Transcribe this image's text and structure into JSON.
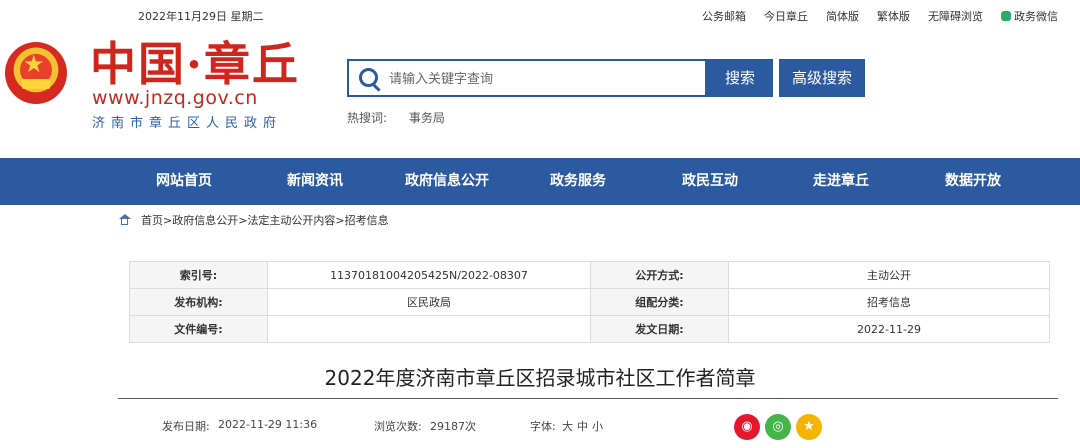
{
  "topbar": {
    "date": "2022年11月29日 星期二",
    "links": [
      "公务邮箱",
      "今日章丘",
      "简体版",
      "繁体版",
      "无障碍浏览"
    ],
    "wechat_label": "政务微信",
    "wechat_color": "#2aae67"
  },
  "logo": {
    "title": "中国·章丘",
    "url": "www.jnzq.gov.cn",
    "subtitle": "济南市章丘区人民政府",
    "emblem_icon": "national-emblem-icon"
  },
  "search": {
    "placeholder": "请输入关键字查询",
    "search_button": "搜索",
    "advanced_button": "高级搜索",
    "hot_label": "热搜词:",
    "hot_keywords": [
      "事务局"
    ]
  },
  "nav": {
    "items": [
      "网站首页",
      "新闻资讯",
      "政府信息公开",
      "政务服务",
      "政民互动",
      "走进章丘",
      "数据开放"
    ],
    "background": "#2c5aa0"
  },
  "breadcrumb": {
    "icon": "home-icon",
    "path": "首页>政府信息公开>法定主动公开内容>招考信息"
  },
  "meta": {
    "rows": [
      {
        "k1": "索引号:",
        "v1": "11370181004205425N/2022-08307",
        "k2": "公开方式:",
        "v2": "主动公开"
      },
      {
        "k1": "发布机构:",
        "v1": "区民政局",
        "k2": "组配分类:",
        "v2": "招考信息"
      },
      {
        "k1": "文件编号:",
        "v1": "",
        "k2": "发文日期:",
        "v2": "2022-11-29"
      }
    ]
  },
  "article": {
    "title": "2022年度济南市章丘区招录城市社区工作者简章",
    "publish_label": "发布日期:",
    "publish_date": "2022-11-29 11:36",
    "views_label": "浏览次数:",
    "views": "29187次",
    "font_label": "字体:",
    "font_sizes": [
      "大",
      "中",
      "小"
    ]
  },
  "share": {
    "weibo_color": "#e6162d",
    "wechat_color": "#44b549",
    "favorite_color": "#f5b400"
  }
}
